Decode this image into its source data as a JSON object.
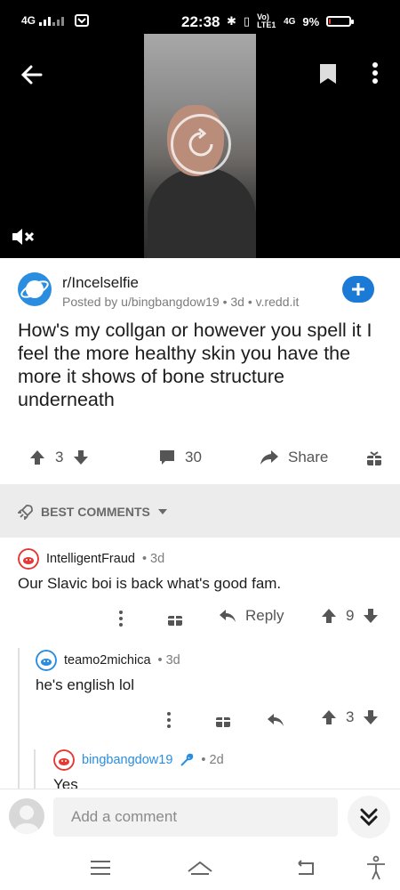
{
  "status_bar": {
    "network": "4G",
    "time": "22:38",
    "volte": "Vo) LTE1",
    "network2": "4G",
    "battery": "9%",
    "battery_level": 0.09
  },
  "video": {
    "back_icon": "arrow-left-icon",
    "bookmark_icon": "bookmark-icon",
    "menu_icon": "more-vertical-icon",
    "mute_icon": "volume-mute-icon",
    "play_icon": "replay-icon"
  },
  "post": {
    "subreddit": "r/Incelselfie",
    "meta": "Posted by u/bingbangdow19 • 3d • v.redd.it",
    "title": "How's my collgan or however you spell it I feel the more healthy skin you have the more it shows of bone structure underneath",
    "votes": "3",
    "comments": "30",
    "share_label": "Share",
    "accent": "#1a7ad6"
  },
  "sort": {
    "label": "BEST COMMENTS"
  },
  "comments": [
    {
      "author": "IntelligentFraud",
      "time": "• 3d",
      "body": "Our Slavic boi is back what's good fam.",
      "reply_label": "Reply",
      "votes": "9"
    },
    {
      "author": "teamo2michica",
      "time": "• 3d",
      "body": "he's english lol",
      "votes": "3"
    },
    {
      "author": "bingbangdow19",
      "time": "• 2d",
      "body": "Yes",
      "author_color": "#2a8de0"
    }
  ],
  "comment_bar": {
    "placeholder": "Add a comment"
  }
}
